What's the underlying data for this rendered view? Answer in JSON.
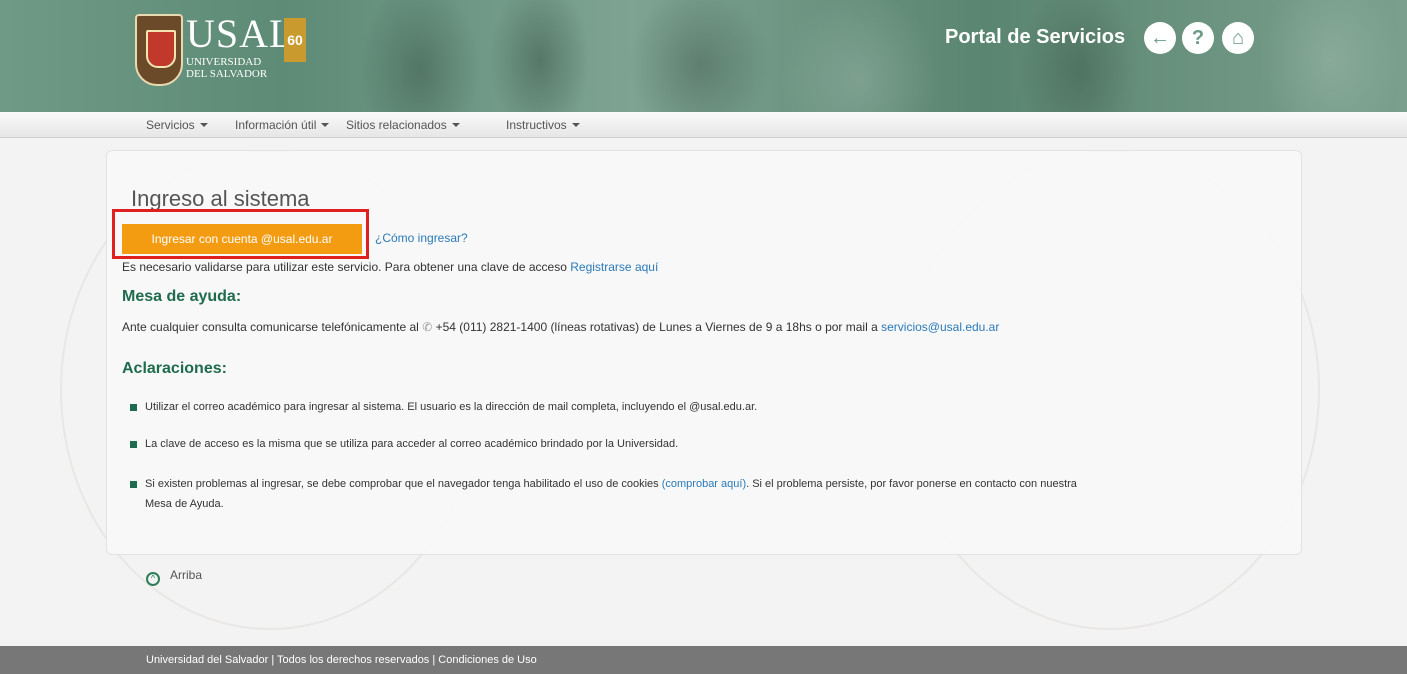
{
  "header": {
    "logo_text": "USAL",
    "logo_sub": "UNIVERSIDAD DEL SALVADOR",
    "anniversary": "60",
    "portal_title": "Portal de Servicios",
    "buttons": [
      {
        "icon": "arrow-left-icon",
        "glyph": "←"
      },
      {
        "icon": "question-icon",
        "glyph": "?"
      },
      {
        "icon": "home-icon",
        "glyph": "⌂"
      }
    ]
  },
  "nav": {
    "items": [
      "Servicios",
      "Información útil",
      "Sitios relacionados",
      "Instructivos"
    ]
  },
  "main": {
    "title": "Ingreso al sistema",
    "login_button": "Ingresar con cuenta @usal.edu.ar",
    "help_link": "¿Cómo ingresar?",
    "note_text": "Es necesario validarse para utilizar este servicio. Para obtener una clave de acceso",
    "register_link": "Registrarse aquí",
    "helpdesk_title": "Mesa de ayuda:",
    "contact_pre": "Ante cualquier consulta comunicarse telefónicamente al",
    "contact_phone": "+54 (011) 2821-1400 (líneas rotativas) de Lunes a Viernes de 9 a 18hs o por mail a",
    "contact_email": "servicios@usal.edu.ar",
    "notes_title": "Aclaraciones:",
    "bullets": [
      "Utilizar el correo académico para ingresar al sistema. El usuario es la dirección de mail completa, incluyendo el @usal.edu.ar.",
      "La clave de acceso es la misma que se utiliza para acceder al correo académico brindado por la Universidad."
    ],
    "bullet3_pre": "Si existen problemas al ingresar, se debe comprobar que el navegador tenga habilitado el uso de cookies",
    "bullet3_link": "(comprobar aquí)",
    "bullet3_post": ". Si el problema persiste, por favor ponerse en contacto con nuestra",
    "bullet3_line2": "Mesa de Ayuda."
  },
  "up_link": "Arriba",
  "footer": "Universidad del Salvador | Todos los derechos reservados | Condiciones de Uso",
  "colors": {
    "accent": "#f39c12",
    "heading_green": "#1f6b4d",
    "link": "#2a7ab8",
    "highlight": "#e02020"
  }
}
